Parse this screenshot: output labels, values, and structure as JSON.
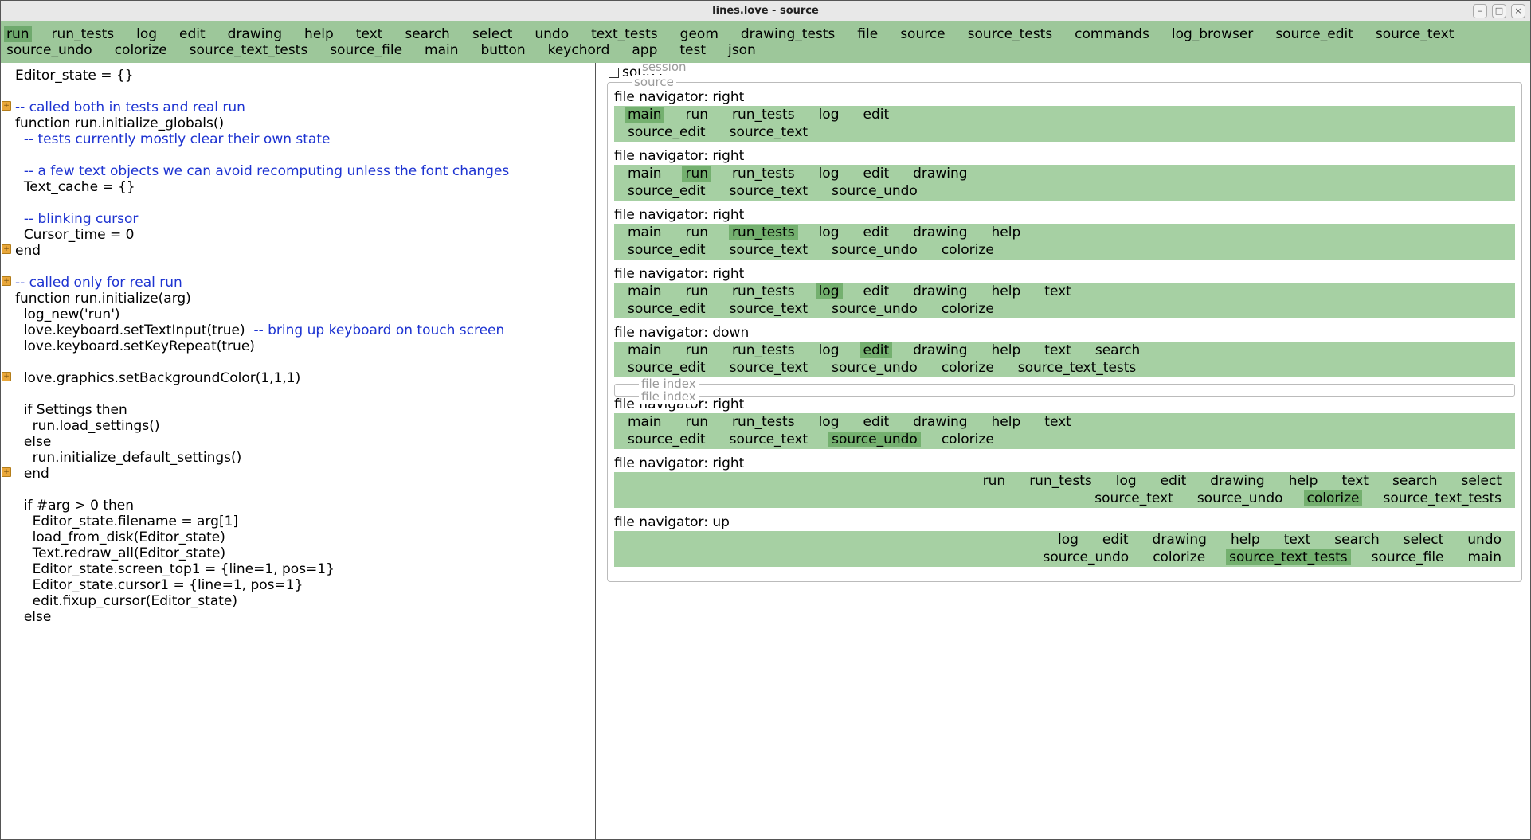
{
  "window": {
    "title": "lines.love - source"
  },
  "topmenu": [
    {
      "label": "run",
      "active": true
    },
    {
      "label": "run_tests"
    },
    {
      "label": "log"
    },
    {
      "label": "edit"
    },
    {
      "label": "drawing"
    },
    {
      "label": "help"
    },
    {
      "label": "text"
    },
    {
      "label": "search"
    },
    {
      "label": "select"
    },
    {
      "label": "undo"
    },
    {
      "label": "text_tests"
    },
    {
      "label": "geom"
    },
    {
      "label": "drawing_tests"
    },
    {
      "label": "file"
    },
    {
      "label": "source"
    },
    {
      "label": "source_tests"
    },
    {
      "label": "commands"
    },
    {
      "label": "log_browser"
    },
    {
      "label": "source_edit"
    },
    {
      "label": "source_text"
    },
    {
      "label": "source_undo"
    },
    {
      "label": "colorize"
    },
    {
      "label": "source_text_tests"
    },
    {
      "label": "source_file"
    },
    {
      "label": "main"
    },
    {
      "label": "button"
    },
    {
      "label": "keychord"
    },
    {
      "label": "app"
    },
    {
      "label": "test"
    },
    {
      "label": "json"
    }
  ],
  "code_lines": [
    {
      "indent": 0,
      "segs": [
        {
          "t": "Editor_state = {}"
        }
      ]
    },
    {
      "indent": 0,
      "segs": []
    },
    {
      "indent": 0,
      "segs": [
        {
          "t": "-- called both in tests and real run",
          "cls": "c"
        }
      ],
      "fold": true
    },
    {
      "indent": 0,
      "segs": [
        {
          "t": "function run.initialize_globals()"
        }
      ]
    },
    {
      "indent": 1,
      "segs": [
        {
          "t": "-- tests currently mostly clear their own state",
          "cls": "c"
        }
      ]
    },
    {
      "indent": 0,
      "segs": []
    },
    {
      "indent": 1,
      "segs": [
        {
          "t": "-- a few text objects we can avoid recomputing unless the font changes",
          "cls": "c"
        }
      ]
    },
    {
      "indent": 1,
      "segs": [
        {
          "t": "Text_cache = {}"
        }
      ]
    },
    {
      "indent": 0,
      "segs": []
    },
    {
      "indent": 1,
      "segs": [
        {
          "t": "-- blinking cursor",
          "cls": "c"
        }
      ]
    },
    {
      "indent": 1,
      "segs": [
        {
          "t": "Cursor_time = 0"
        }
      ]
    },
    {
      "indent": 0,
      "segs": [
        {
          "t": "end"
        }
      ],
      "fold": true
    },
    {
      "indent": 0,
      "segs": []
    },
    {
      "indent": 0,
      "segs": [
        {
          "t": "-- called only for real run",
          "cls": "c"
        }
      ],
      "fold": true
    },
    {
      "indent": 0,
      "segs": [
        {
          "t": "function run.initialize(arg)"
        }
      ]
    },
    {
      "indent": 1,
      "segs": [
        {
          "t": "log_new('run')"
        }
      ]
    },
    {
      "indent": 1,
      "segs": [
        {
          "t": "love.keyboard.setTextInput(true)  "
        },
        {
          "t": "-- bring up keyboard on touch screen",
          "cls": "c"
        }
      ]
    },
    {
      "indent": 1,
      "segs": [
        {
          "t": "love.keyboard.setKeyRepeat(true)"
        }
      ]
    },
    {
      "indent": 0,
      "segs": []
    },
    {
      "indent": 1,
      "segs": [
        {
          "t": "love.graphics.setBackgroundColor(1,1,1)"
        }
      ],
      "fold": true
    },
    {
      "indent": 0,
      "segs": []
    },
    {
      "indent": 1,
      "segs": [
        {
          "t": "if Settings then"
        }
      ]
    },
    {
      "indent": 2,
      "segs": [
        {
          "t": "run.load_settings()"
        }
      ]
    },
    {
      "indent": 1,
      "segs": [
        {
          "t": "else"
        }
      ]
    },
    {
      "indent": 2,
      "segs": [
        {
          "t": "run.initialize_default_settings()"
        }
      ]
    },
    {
      "indent": 1,
      "segs": [
        {
          "t": "end"
        }
      ],
      "fold": true
    },
    {
      "indent": 0,
      "segs": []
    },
    {
      "indent": 1,
      "segs": [
        {
          "t": "if #arg > 0 then"
        }
      ]
    },
    {
      "indent": 2,
      "segs": [
        {
          "t": "Editor_state.filename = arg[1]"
        }
      ]
    },
    {
      "indent": 2,
      "segs": [
        {
          "t": "load_from_disk(Editor_state)"
        }
      ]
    },
    {
      "indent": 2,
      "segs": [
        {
          "t": "Text.redraw_all(Editor_state)"
        }
      ]
    },
    {
      "indent": 2,
      "segs": [
        {
          "t": "Editor_state.screen_top1 = {line=1, pos=1}"
        }
      ]
    },
    {
      "indent": 2,
      "segs": [
        {
          "t": "Editor_state.cursor1 = {line=1, pos=1}"
        }
      ]
    },
    {
      "indent": 2,
      "segs": [
        {
          "t": "edit.fixup_cursor(Editor_state)"
        }
      ]
    },
    {
      "indent": 1,
      "segs": [
        {
          "t": "else"
        }
      ]
    }
  ],
  "logpanel": {
    "session_label": "session",
    "checkbox_label": "source",
    "source_label": "source",
    "file_index_label": "file index",
    "entries": [
      {
        "heading": "file navigator: right",
        "align": "left",
        "rows": [
          [
            {
              "t": "main",
              "a": true
            },
            {
              "t": "run"
            },
            {
              "t": "run_tests"
            },
            {
              "t": "log"
            },
            {
              "t": "edit"
            }
          ],
          [
            {
              "t": "source_edit"
            },
            {
              "t": "source_text"
            }
          ]
        ]
      },
      {
        "heading": "file navigator: right",
        "align": "left",
        "rows": [
          [
            {
              "t": "main"
            },
            {
              "t": "run",
              "a": true
            },
            {
              "t": "run_tests"
            },
            {
              "t": "log"
            },
            {
              "t": "edit"
            },
            {
              "t": "drawing"
            }
          ],
          [
            {
              "t": "source_edit"
            },
            {
              "t": "source_text"
            },
            {
              "t": "source_undo"
            }
          ]
        ]
      },
      {
        "heading": "file navigator: right",
        "align": "left",
        "rows": [
          [
            {
              "t": "main"
            },
            {
              "t": "run"
            },
            {
              "t": "run_tests",
              "a": true
            },
            {
              "t": "log"
            },
            {
              "t": "edit"
            },
            {
              "t": "drawing"
            },
            {
              "t": "help"
            }
          ],
          [
            {
              "t": "source_edit"
            },
            {
              "t": "source_text"
            },
            {
              "t": "source_undo"
            },
            {
              "t": "colorize"
            }
          ]
        ]
      },
      {
        "heading": "file navigator: right",
        "align": "left",
        "rows": [
          [
            {
              "t": "main"
            },
            {
              "t": "run"
            },
            {
              "t": "run_tests"
            },
            {
              "t": "log",
              "a": true
            },
            {
              "t": "edit"
            },
            {
              "t": "drawing"
            },
            {
              "t": "help"
            },
            {
              "t": "text"
            }
          ],
          [
            {
              "t": "source_edit"
            },
            {
              "t": "source_text"
            },
            {
              "t": "source_undo"
            },
            {
              "t": "colorize"
            }
          ]
        ]
      },
      {
        "heading": "file navigator: down",
        "align": "left",
        "rows": [
          [
            {
              "t": "main"
            },
            {
              "t": "run"
            },
            {
              "t": "run_tests"
            },
            {
              "t": "log"
            },
            {
              "t": "edit",
              "a": true
            },
            {
              "t": "drawing"
            },
            {
              "t": "help"
            },
            {
              "t": "text"
            },
            {
              "t": "search"
            }
          ],
          [
            {
              "t": "source_edit"
            },
            {
              "t": "source_text"
            },
            {
              "t": "source_undo"
            },
            {
              "t": "colorize"
            },
            {
              "t": "source_text_tests"
            }
          ]
        ]
      },
      {
        "heading": "__FILE_INDEX__"
      },
      {
        "heading": "file navigator: right",
        "align": "left",
        "rows": [
          [
            {
              "t": "main"
            },
            {
              "t": "run"
            },
            {
              "t": "run_tests"
            },
            {
              "t": "log"
            },
            {
              "t": "edit"
            },
            {
              "t": "drawing"
            },
            {
              "t": "help"
            },
            {
              "t": "text"
            }
          ],
          [
            {
              "t": "source_edit"
            },
            {
              "t": "source_text"
            },
            {
              "t": "source_undo",
              "a": true
            },
            {
              "t": "colorize"
            }
          ]
        ]
      },
      {
        "heading": "file navigator: right",
        "align": "right",
        "rows": [
          [
            {
              "t": "run"
            },
            {
              "t": "run_tests"
            },
            {
              "t": "log"
            },
            {
              "t": "edit"
            },
            {
              "t": "drawing"
            },
            {
              "t": "help"
            },
            {
              "t": "text"
            },
            {
              "t": "search"
            },
            {
              "t": "select"
            }
          ],
          [
            {
              "t": "source_text"
            },
            {
              "t": "source_undo"
            },
            {
              "t": "colorize",
              "a": true
            },
            {
              "t": "source_text_tests"
            }
          ]
        ]
      },
      {
        "heading": "file navigator: up",
        "align": "right",
        "rows": [
          [
            {
              "t": "log"
            },
            {
              "t": "edit"
            },
            {
              "t": "drawing"
            },
            {
              "t": "help"
            },
            {
              "t": "text"
            },
            {
              "t": "search"
            },
            {
              "t": "select"
            },
            {
              "t": "undo"
            }
          ],
          [
            {
              "t": "source_undo"
            },
            {
              "t": "colorize"
            },
            {
              "t": "source_text_tests",
              "a": true
            },
            {
              "t": "source_file"
            },
            {
              "t": "main"
            }
          ]
        ]
      }
    ]
  }
}
